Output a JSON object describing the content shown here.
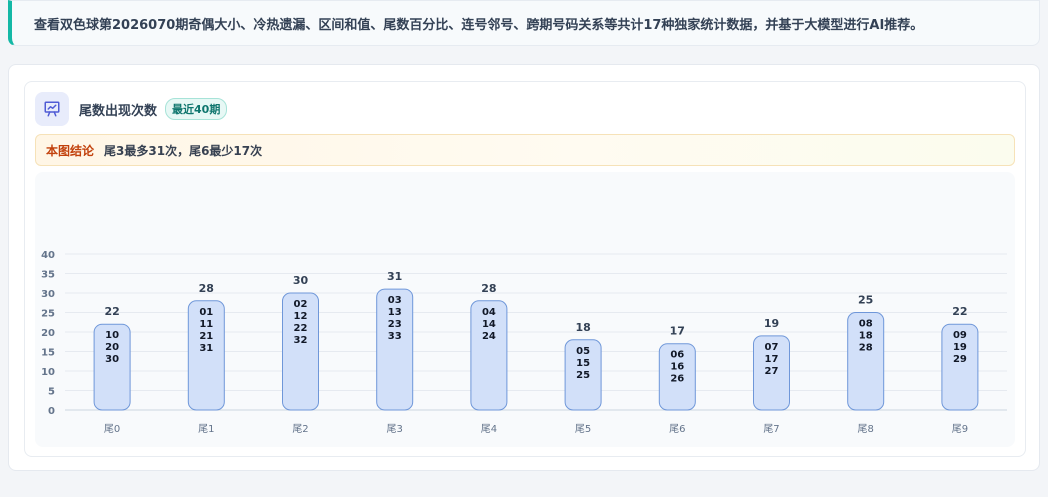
{
  "notice": {
    "text": "查看双色球第2026070期奇偶大小、冷热遗漏、区间和值、尾数百分比、连号邻号、跨期号码关系等共计17种独家统计数据，并基于大模型进行AI推荐。"
  },
  "card": {
    "icon": "presentation-chart-icon",
    "title": "尾数出现次数",
    "badge": "最近40期",
    "conclusion_tag": "本图结论",
    "conclusion_text": "尾3最多31次，尾6最少17次"
  },
  "colors": {
    "accent": "#14b8a6",
    "bar_fill": "#d2e0f9",
    "bar_stroke": "#6f97d9"
  },
  "chart_data": {
    "type": "bar",
    "categories": [
      "尾0",
      "尾1",
      "尾2",
      "尾3",
      "尾4",
      "尾5",
      "尾6",
      "尾7",
      "尾8",
      "尾9"
    ],
    "values": [
      22,
      28,
      30,
      31,
      28,
      18,
      17,
      19,
      25,
      22
    ],
    "bar_labels": [
      [
        "10",
        "20",
        "30"
      ],
      [
        "01",
        "11",
        "21",
        "31"
      ],
      [
        "02",
        "12",
        "22",
        "32"
      ],
      [
        "03",
        "13",
        "23",
        "33"
      ],
      [
        "04",
        "14",
        "24"
      ],
      [
        "05",
        "15",
        "25"
      ],
      [
        "06",
        "16",
        "26"
      ],
      [
        "07",
        "17",
        "27"
      ],
      [
        "08",
        "18",
        "28"
      ],
      [
        "09",
        "19",
        "29"
      ]
    ],
    "title": "",
    "xlabel": "",
    "ylabel": "",
    "ylim": [
      0,
      40
    ],
    "yticks": [
      0,
      5,
      10,
      15,
      20,
      25,
      30,
      35,
      40
    ],
    "grid": true
  }
}
